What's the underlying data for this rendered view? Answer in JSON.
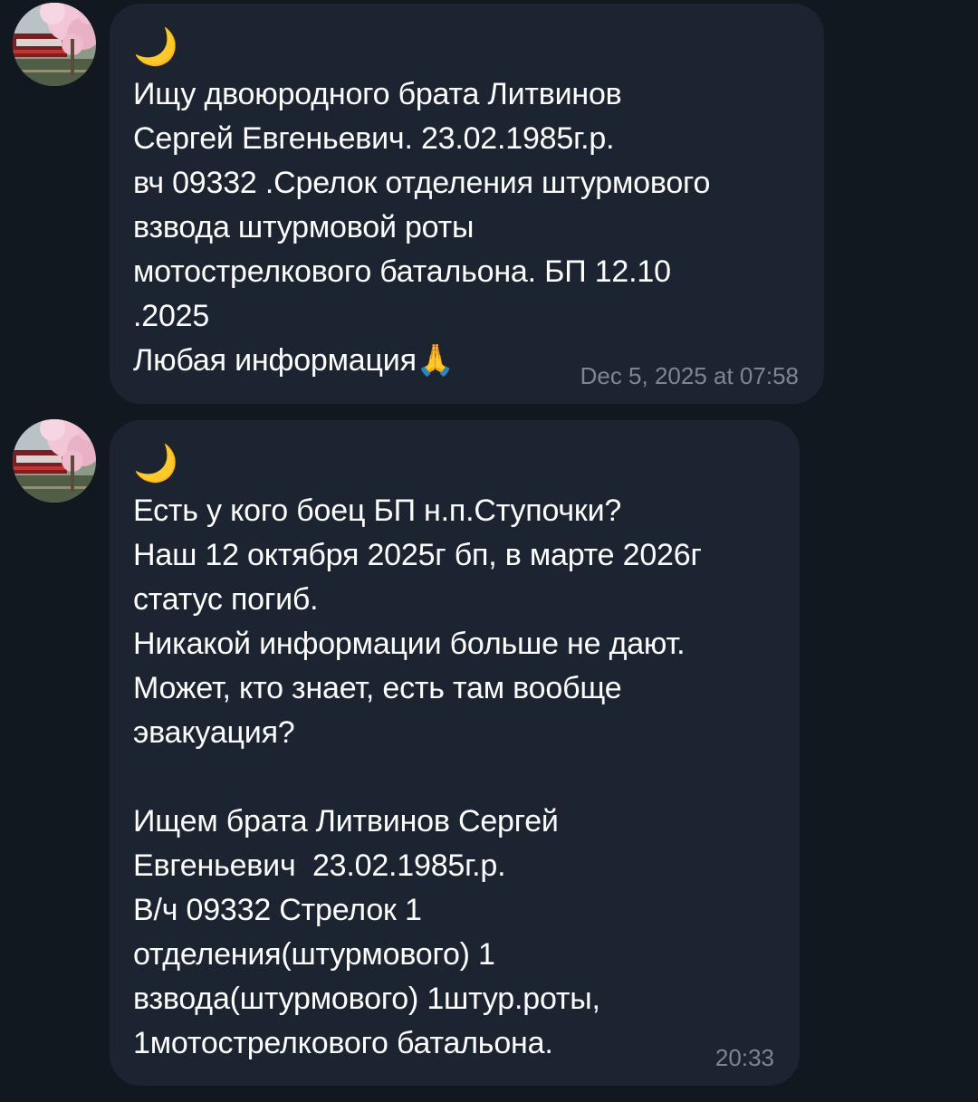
{
  "messages": [
    {
      "icon": "moon-emoji",
      "moon": "🌙",
      "text": "Ищу двоюродного брата Литвинов\nСергей Евгеньевич. 23.02.1985г.р.\nвч 09332 .Срелок отделения штурмового\nвзвода штурмовой роты\nмотострелкового батальона. БП 12.10\n.2025\nЛюбая информация🙏",
      "time": "Dec 5, 2025 at 07:58"
    },
    {
      "icon": "moon-emoji",
      "moon": "🌙",
      "text": "Есть у кого боец БП н.п.Ступочки?\nНаш 12 октября 2025г бп, в марте 2026г\nстатус погиб.\nНикакой информации больше не дают.\nМожет, кто знает, есть там вообще\nэвакуация?\n\nИщем брата Литвинов Сергей\nЕвгеньевич  23.02.1985г.р.\nВ/ч 09332 Стрелок 1\nотделения(штурмового) 1\nвзвода(штурмового) 1штур.роты,\n1мотострелкового батальона.",
      "time": "20:33"
    }
  ],
  "colors": {
    "background": "#111820",
    "bubble": "#1c2432",
    "text": "#ffffff",
    "timestamp": "#7d8794"
  }
}
